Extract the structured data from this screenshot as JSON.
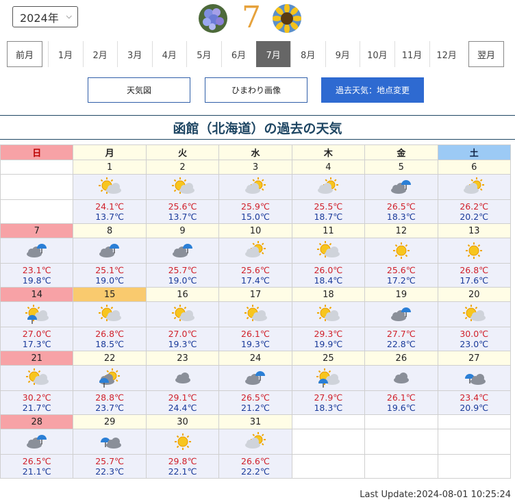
{
  "year_select": {
    "value": "2024年"
  },
  "header": {
    "month_big": "7",
    "left_icon": "hydrangea-icon",
    "right_icon": "sunflower-icon"
  },
  "nav": {
    "prev": "前月",
    "next": "翌月",
    "months": [
      "1月",
      "2月",
      "3月",
      "4月",
      "5月",
      "6月",
      "7月",
      "8月",
      "9月",
      "10月",
      "11月",
      "12月"
    ],
    "selected_index": 6
  },
  "links": {
    "weather_map": "天気図",
    "himawari": "ひまわり画像",
    "past_weather": "過去天気：地点変更"
  },
  "title": "函館（北海道）の過去の天気",
  "weekdays": [
    "日",
    "月",
    "火",
    "水",
    "木",
    "金",
    "土"
  ],
  "weeks": [
    [
      null,
      {
        "day": "1",
        "icon": "sun-cloud-icon",
        "hi": "24.1℃",
        "lo": "13.7℃"
      },
      {
        "day": "2",
        "icon": "sun-cloud-icon",
        "hi": "25.6℃",
        "lo": "13.7℃"
      },
      {
        "day": "3",
        "icon": "cloud-sun-icon",
        "hi": "25.9℃",
        "lo": "15.0℃"
      },
      {
        "day": "4",
        "icon": "cloud-sun-icon",
        "hi": "25.5℃",
        "lo": "18.7℃"
      },
      {
        "day": "5",
        "icon": "cloud-rain-icon",
        "hi": "26.5℃",
        "lo": "18.3℃"
      },
      {
        "day": "6",
        "icon": "cloud-sun-icon",
        "hi": "26.2℃",
        "lo": "20.2℃"
      }
    ],
    [
      {
        "day": "7",
        "icon": "cloud-rain-icon",
        "hi": "23.1℃",
        "lo": "19.8℃"
      },
      {
        "day": "8",
        "icon": "cloud-rain-icon",
        "hi": "25.1℃",
        "lo": "19.0℃"
      },
      {
        "day": "9",
        "icon": "cloud-rain-icon",
        "hi": "25.7℃",
        "lo": "19.0℃"
      },
      {
        "day": "10",
        "icon": "cloud-sun-icon",
        "hi": "25.6℃",
        "lo": "17.4℃"
      },
      {
        "day": "11",
        "icon": "sun-cloud-icon",
        "hi": "26.0℃",
        "lo": "18.4℃"
      },
      {
        "day": "12",
        "icon": "sun-icon",
        "hi": "25.6℃",
        "lo": "17.2℃"
      },
      {
        "day": "13",
        "icon": "sun-icon",
        "hi": "26.8℃",
        "lo": "17.6℃"
      }
    ],
    [
      {
        "day": "14",
        "icon": "sun-cloud-rain-icon",
        "hi": "27.0℃",
        "lo": "17.3℃"
      },
      {
        "day": "15",
        "icon": "sun-cloud-icon",
        "hi": "26.8℃",
        "lo": "18.5℃"
      },
      {
        "day": "16",
        "icon": "sun-cloud-icon",
        "hi": "27.0℃",
        "lo": "19.3℃"
      },
      {
        "day": "17",
        "icon": "sun-cloud-icon",
        "hi": "26.1℃",
        "lo": "19.3℃"
      },
      {
        "day": "18",
        "icon": "sun-cloud-icon",
        "hi": "29.3℃",
        "lo": "19.9℃"
      },
      {
        "day": "19",
        "icon": "cloud-rain-icon",
        "hi": "27.7℃",
        "lo": "22.8℃"
      },
      {
        "day": "20",
        "icon": "sun-cloud-icon",
        "hi": "30.0℃",
        "lo": "23.0℃"
      }
    ],
    [
      {
        "day": "21",
        "icon": "sun-cloud-icon",
        "hi": "30.2℃",
        "lo": "21.7℃"
      },
      {
        "day": "22",
        "icon": "cloud-sun-rain-icon",
        "hi": "28.8℃",
        "lo": "23.7℃"
      },
      {
        "day": "23",
        "icon": "cloud-icon",
        "hi": "29.1℃",
        "lo": "24.4℃"
      },
      {
        "day": "24",
        "icon": "cloud-rain-icon",
        "hi": "26.5℃",
        "lo": "21.2℃"
      },
      {
        "day": "25",
        "icon": "sun-cloud-rain-icon",
        "hi": "27.9℃",
        "lo": "18.3℃"
      },
      {
        "day": "26",
        "icon": "cloud-icon",
        "hi": "26.1℃",
        "lo": "19.6℃"
      },
      {
        "day": "27",
        "icon": "rain-cloud-icon",
        "hi": "23.4℃",
        "lo": "20.9℃"
      }
    ],
    [
      {
        "day": "28",
        "icon": "cloud-rain-icon",
        "hi": "26.5℃",
        "lo": "21.1℃"
      },
      {
        "day": "29",
        "icon": "rain-cloud-icon",
        "hi": "25.7℃",
        "lo": "22.3℃"
      },
      {
        "day": "30",
        "icon": "sun-icon",
        "hi": "29.8℃",
        "lo": "22.1℃"
      },
      {
        "day": "31",
        "icon": "cloud-sun-icon",
        "hi": "26.6℃",
        "lo": "22.2℃"
      },
      null,
      null,
      null
    ]
  ],
  "today_day": "15",
  "footer": {
    "last_update": "Last Update:2024-08-01 10:25:24"
  },
  "colors": {
    "sunday": "#f7a2a6",
    "saturday": "#9ccaf5",
    "today": "#f9ca6e",
    "high": "#d0202a",
    "low": "#1a3a9a",
    "accent": "#2e6ad1"
  }
}
